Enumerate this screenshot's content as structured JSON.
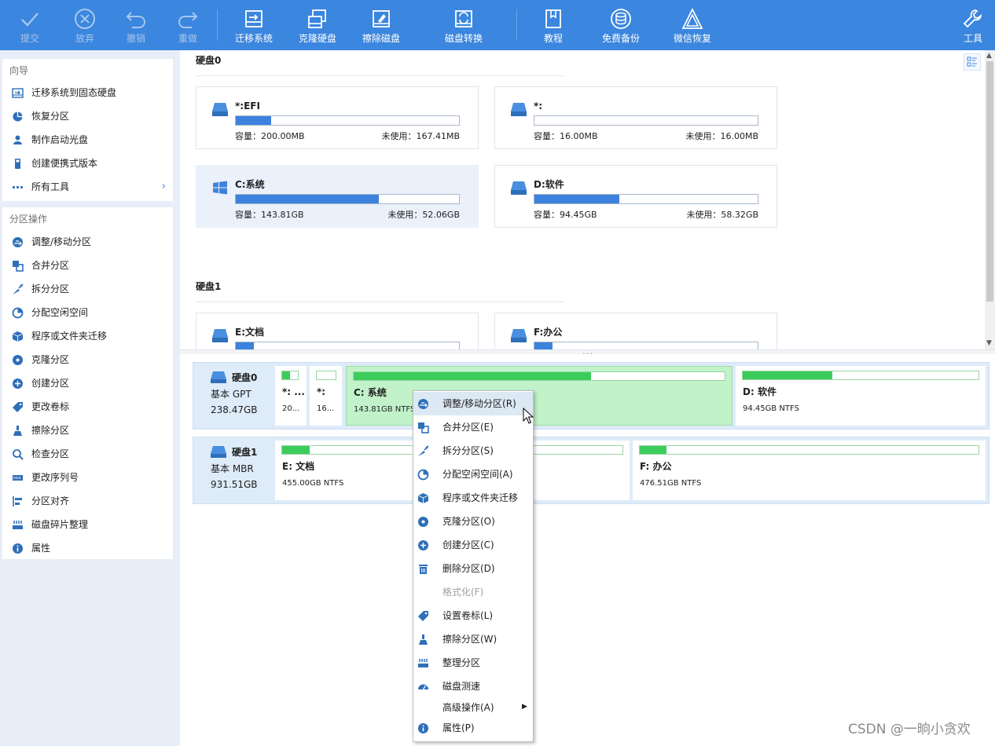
{
  "toolbar": {
    "items": [
      {
        "label": "提交",
        "icon": "check-icon",
        "enabled": false
      },
      {
        "label": "放弃",
        "icon": "cancel-circle-icon",
        "enabled": false
      },
      {
        "label": "撤销",
        "icon": "undo-icon",
        "enabled": false
      },
      {
        "label": "重做",
        "icon": "redo-icon",
        "enabled": false
      },
      {
        "label": "迁移系统",
        "icon": "migrate-os-icon",
        "enabled": true
      },
      {
        "label": "克隆硬盘",
        "icon": "clone-disk-icon",
        "enabled": true
      },
      {
        "label": "擦除磁盘",
        "icon": "wipe-disk-icon",
        "enabled": true
      },
      {
        "label": "磁盘转换",
        "icon": "convert-disk-icon",
        "enabled": true
      },
      {
        "label": "教程",
        "icon": "tutorial-book-icon",
        "enabled": true
      },
      {
        "label": "免费备份",
        "icon": "backup-icon",
        "enabled": true
      },
      {
        "label": "微信恢复",
        "icon": "recovery-icon",
        "enabled": true
      },
      {
        "label": "工具",
        "icon": "wrench-icon",
        "enabled": true
      }
    ]
  },
  "sidebar": {
    "wizard": {
      "title": "向导",
      "items": [
        {
          "label": "迁移系统到固态硬盘",
          "icon": "migrate-ssd-icon"
        },
        {
          "label": "恢复分区",
          "icon": "recover-partition-icon"
        },
        {
          "label": "制作启动光盘",
          "icon": "boot-disc-icon"
        },
        {
          "label": "创建便携式版本",
          "icon": "portable-usb-icon"
        },
        {
          "label": "所有工具",
          "icon": "more-dots-icon"
        }
      ]
    },
    "partition_ops": {
      "title": "分区操作",
      "items": [
        {
          "label": "调整/移动分区",
          "icon": "resize-partition-icon"
        },
        {
          "label": "合并分区",
          "icon": "merge-partition-icon"
        },
        {
          "label": "拆分分区",
          "icon": "split-partition-icon"
        },
        {
          "label": "分配空闲空间",
          "icon": "allocate-space-icon"
        },
        {
          "label": "程序或文件夹迁移",
          "icon": "app-mover-icon"
        },
        {
          "label": "克隆分区",
          "icon": "clone-partition-icon"
        },
        {
          "label": "创建分区",
          "icon": "create-partition-icon"
        },
        {
          "label": "更改卷标",
          "icon": "label-tag-icon"
        },
        {
          "label": "擦除分区",
          "icon": "wipe-partition-icon"
        },
        {
          "label": "检查分区",
          "icon": "check-partition-icon"
        },
        {
          "label": "更改序列号",
          "icon": "serial-number-icon"
        },
        {
          "label": "分区对齐",
          "icon": "align-partition-icon"
        },
        {
          "label": "磁盘碎片整理",
          "icon": "defrag-icon"
        },
        {
          "label": "属性",
          "icon": "info-icon"
        }
      ]
    }
  },
  "disks": [
    {
      "name": "硬盘0",
      "partitions": [
        {
          "name": "*:EFI",
          "capacity": "容量：200.00MB",
          "unused": "未使用：167.41MB",
          "used_fraction": 0.16,
          "selected": false,
          "os": false
        },
        {
          "name": "*:",
          "capacity": "容量：16.00MB",
          "unused": "未使用：16.00MB",
          "used_fraction": 0.0,
          "selected": false,
          "os": false
        },
        {
          "name": "C:系统",
          "capacity": "容量：143.81GB",
          "unused": "未使用：52.06GB",
          "used_fraction": 0.64,
          "selected": true,
          "os": true
        },
        {
          "name": "D:软件",
          "capacity": "容量：94.45GB",
          "unused": "未使用：58.32GB",
          "used_fraction": 0.38,
          "selected": false,
          "os": false
        }
      ]
    },
    {
      "name": "硬盘1",
      "partitions": [
        {
          "name": "E:文档",
          "used_fraction": 0.08,
          "selected": false,
          "os": false
        },
        {
          "name": "F:办公",
          "used_fraction": 0.08,
          "selected": false,
          "os": false
        }
      ]
    }
  ],
  "disk_map": [
    {
      "name": "硬盘0",
      "type": "基本 GPT",
      "size": "238.47GB",
      "segments": [
        {
          "name": "*: ...",
          "fs": "20...",
          "used_fraction": 0.5,
          "selected": false
        },
        {
          "name": "*:",
          "fs": "16...",
          "used_fraction": 0.0,
          "selected": false
        },
        {
          "name": "C: 系统",
          "fs": "143.81GB NTFS",
          "used_fraction": 0.64,
          "selected": true
        },
        {
          "name": "D: 软件",
          "fs": "94.45GB NTFS",
          "used_fraction": 0.38,
          "selected": false
        }
      ]
    },
    {
      "name": "硬盘1",
      "type": "基本 MBR",
      "size": "931.51GB",
      "segments": [
        {
          "name": "E: 文档",
          "fs": "455.00GB NTFS",
          "used_fraction": 0.08,
          "selected": false
        },
        {
          "name": "F: 办公",
          "fs": "476.51GB NTFS",
          "used_fraction": 0.08,
          "selected": false
        }
      ]
    }
  ],
  "context_menu": {
    "items": [
      {
        "label": "调整/移动分区(R)",
        "icon": "resize-partition-icon",
        "enabled": true,
        "hot": true
      },
      {
        "label": "合并分区(E)",
        "icon": "merge-partition-icon",
        "enabled": true
      },
      {
        "label": "拆分分区(S)",
        "icon": "split-partition-icon",
        "enabled": true
      },
      {
        "label": "分配空闲空间(A)",
        "icon": "allocate-space-icon",
        "enabled": true
      },
      {
        "label": "程序或文件夹迁移",
        "icon": "app-mover-icon",
        "enabled": true
      },
      {
        "label": "克隆分区(O)",
        "icon": "clone-partition-icon",
        "enabled": true
      },
      {
        "label": "创建分区(C)",
        "icon": "create-partition-icon",
        "enabled": true
      },
      {
        "label": "删除分区(D)",
        "icon": "trash-icon",
        "enabled": true
      },
      {
        "label": "格式化(F)",
        "icon": "",
        "enabled": false
      },
      {
        "label": "设置卷标(L)",
        "icon": "label-tag-icon",
        "enabled": true
      },
      {
        "label": "擦除分区(W)",
        "icon": "wipe-partition-icon",
        "enabled": true
      },
      {
        "label": "整理分区",
        "icon": "defrag-icon",
        "enabled": true
      },
      {
        "label": "磁盘测速",
        "icon": "speed-gauge-icon",
        "enabled": true
      },
      {
        "label": "高级操作(A)",
        "icon": "",
        "enabled": true,
        "submenu": true
      },
      {
        "label": "属性(P)",
        "icon": "info-icon",
        "enabled": true
      }
    ]
  },
  "watermark": "CSDN @一晌小贪欢",
  "colors": {
    "toolbar": "#3b86de",
    "accent": "#3d82dd",
    "map_used": "#3ccc5c",
    "map_selected": "#c1f2c9"
  }
}
